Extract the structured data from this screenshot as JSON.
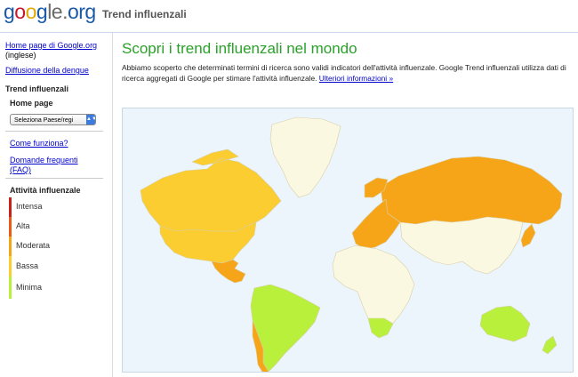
{
  "header": {
    "logo": {
      "g1": "g",
      "o1": "o",
      "o2": "o",
      "g2": "g",
      "le": "le",
      "dot": ".",
      "org": "org"
    },
    "title": "Trend influenzali"
  },
  "sidebar": {
    "home_link_label": "Home page di Google.org",
    "home_link_note": "(inglese)",
    "dengue_link": "Diffusione della dengue",
    "section_title": "Trend influenzali",
    "home_label": "Home page",
    "country_select_value": "Seleziona Paese/regi",
    "how_link": "Come funziona?",
    "faq_link": "Domande frequenti (FAQ)",
    "activity_title": "Attività influenzale",
    "levels": [
      {
        "label": "Intensa",
        "color": "#c9221b"
      },
      {
        "label": "Alta",
        "color": "#ea5a1c"
      },
      {
        "label": "Moderata",
        "color": "#f6a519"
      },
      {
        "label": "Bassa",
        "color": "#fbcd30"
      },
      {
        "label": "Minima",
        "color": "#b9f03c"
      }
    ]
  },
  "main": {
    "title": "Scopri i trend influenzali nel mondo",
    "intro": "Abbiamo scoperto che determinati termini di ricerca sono validi indicatori dell'attività influenzale. Google Trend influenzali utilizza dati di ricerca aggregati di Google per stimare l'attività influenzale.",
    "more_link": "Ulteriori informazioni »"
  },
  "map": {
    "ocean_color": "#ebf5fb",
    "no_data_color": "#fbf8e1",
    "regions": [
      {
        "name": "Groenlandia",
        "level": "none"
      },
      {
        "name": "Canada",
        "level": "Bassa"
      },
      {
        "name": "Stati Uniti",
        "level": "Bassa"
      },
      {
        "name": "Messico",
        "level": "Moderata"
      },
      {
        "name": "Sud America",
        "level": "Minima"
      },
      {
        "name": "Cile",
        "level": "Moderata"
      },
      {
        "name": "Russia",
        "level": "Moderata"
      },
      {
        "name": "Europa",
        "level": "Moderata"
      },
      {
        "name": "Africa",
        "level": "none"
      },
      {
        "name": "Sudafrica",
        "level": "Minima"
      },
      {
        "name": "Australia",
        "level": "Minima"
      },
      {
        "name": "Nuova Zelanda",
        "level": "Minima"
      },
      {
        "name": "Giappone",
        "level": "Moderata"
      }
    ]
  }
}
